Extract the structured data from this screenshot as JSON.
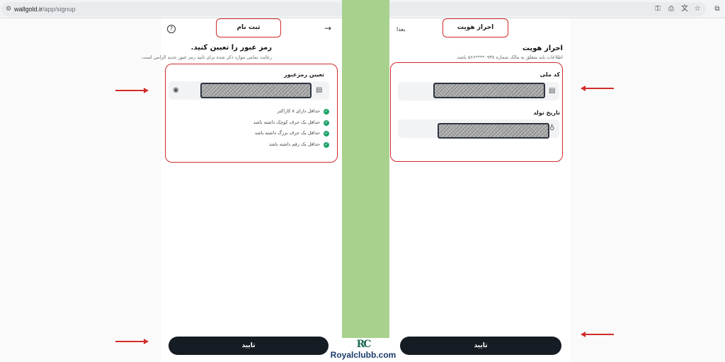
{
  "browser": {
    "url_host": "wallgold.ir",
    "url_path": "/app/signup",
    "icons": [
      "tune-icon",
      "key-icon",
      "install-icon",
      "translate-icon",
      "star-icon",
      "extensions-icon"
    ]
  },
  "left_panel": {
    "header_title": "ثبت نام",
    "help_icon": "?",
    "back_icon": "→",
    "title": "رمز عبور را تعیین کنید.",
    "subtitle": "رعایت تمامی موارد ذکر شده برای تایید رمز عبور جدید الزامی است.",
    "field_label": "تعیین رمزعبور",
    "rules": [
      "حداقل دارای ۸ کاراکتر",
      "حداقل یک حرف کوچک داشته باشد",
      "حداقل یک حرف بزرگ داشته باشد",
      "حداقل یک رقم داشته باشد"
    ],
    "confirm_label": "تایید"
  },
  "right_panel": {
    "header_title": "احراز هویت",
    "later_label": "بعدا",
    "title": "احراز هویت",
    "subtitle": "اطلاعات باید متعلق به مالک شماره ۰۹۳۸****۵۶۶ باشد.",
    "national_code_label": "کد ملی",
    "birth_date_label": "تاریخ تولد",
    "confirm_label": "تایید"
  },
  "watermark": {
    "mark": "RC",
    "text": "Royalclubb.com"
  },
  "colors": {
    "highlight_red": "#d12c2c",
    "button_dark": "#161c24",
    "check_green": "#1fa36a",
    "strip_green": "#a7d18c"
  }
}
